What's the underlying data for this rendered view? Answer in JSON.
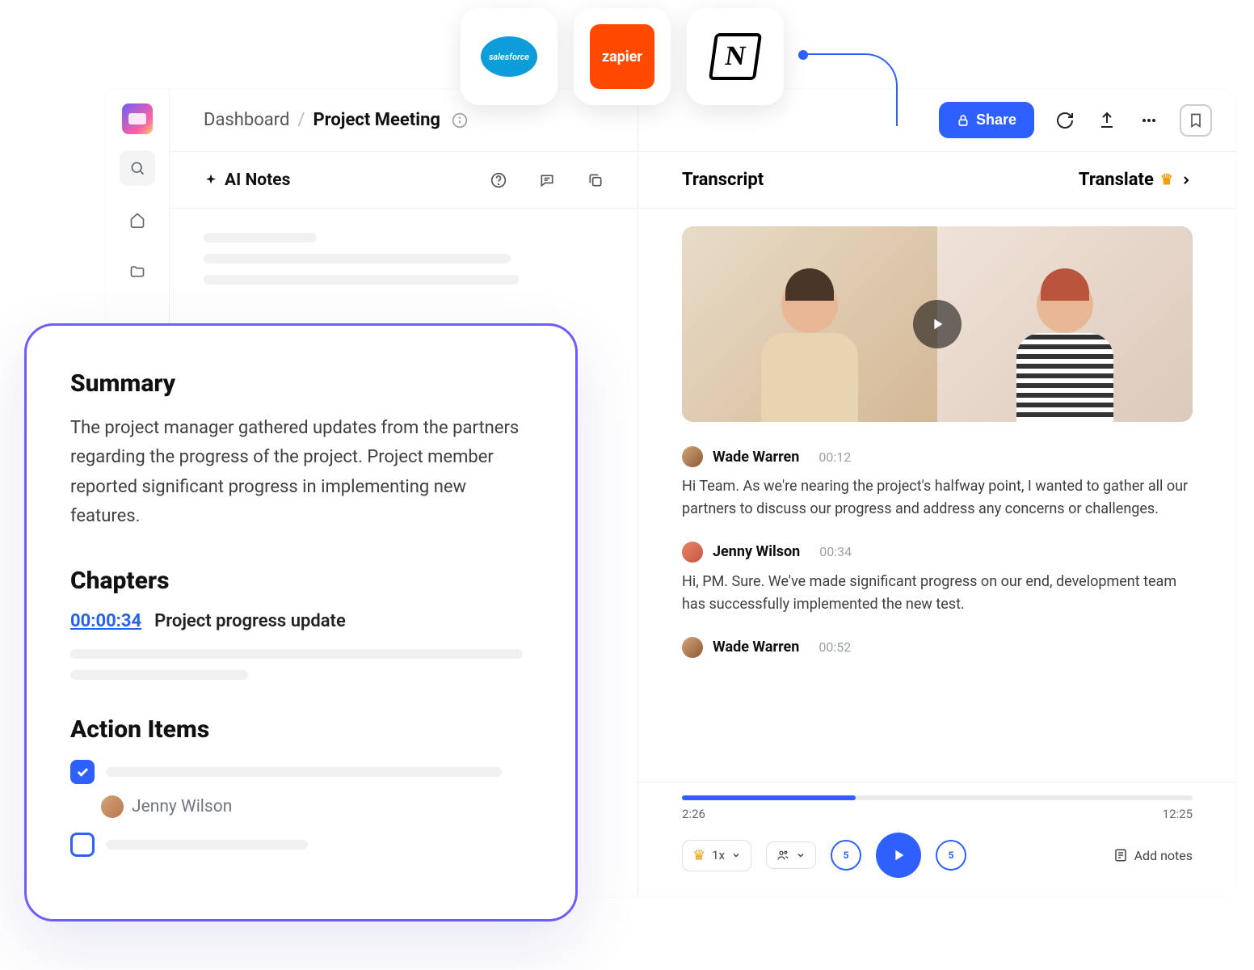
{
  "integrations": [
    {
      "name": "salesforce",
      "label": "salesforce"
    },
    {
      "name": "zapier",
      "label": "zapier"
    },
    {
      "name": "notion",
      "label": "N"
    }
  ],
  "breadcrumb": {
    "root": "Dashboard",
    "sep": "/",
    "current": "Project Meeting"
  },
  "share_label": "Share",
  "ai_notes_tab": "AI Notes",
  "transcript_tab": "Transcript",
  "translate_label": "Translate",
  "summary": {
    "title": "Summary",
    "body": "The project manager gathered updates from the partners regarding the progress of the project. Project member reported significant progress in implementing new features."
  },
  "chapters": {
    "title": "Chapters",
    "items": [
      {
        "ts": "00:00:34",
        "label": "Project progress update"
      }
    ]
  },
  "action_items": {
    "title": "Action Items",
    "items": [
      {
        "checked": true,
        "assignee": "Jenny Wilson"
      },
      {
        "checked": false
      }
    ]
  },
  "transcript": [
    {
      "speaker": "Wade Warren",
      "time": "00:12",
      "text": "Hi Team. As we're nearing the project's halfway point, I wanted to gather all our partners to discuss our progress and address any concerns or challenges."
    },
    {
      "speaker": "Jenny Wilson",
      "time": "00:34",
      "text": "Hi, PM. Sure. We've made significant progress on our end, development team has successfully implemented the new test."
    },
    {
      "speaker": "Wade Warren",
      "time": "00:52",
      "text": ""
    }
  ],
  "player": {
    "elapsed": "2:26",
    "total": "12:25",
    "speed": "1x",
    "skip_seconds": "5",
    "add_notes": "Add notes"
  }
}
